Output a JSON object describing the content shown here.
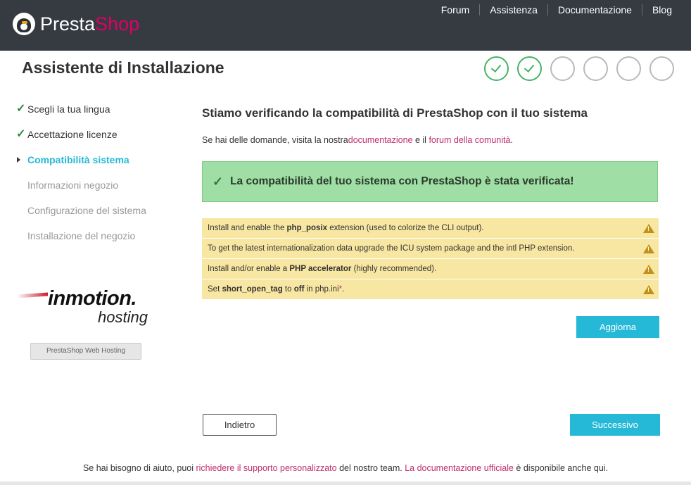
{
  "brand": {
    "logo_part1": "Presta",
    "logo_part2": "Shop"
  },
  "topnav": [
    "Forum",
    "Assistenza",
    "Documentazione",
    "Blog"
  ],
  "page_title": "Assistente di Installazione",
  "steps_progress": {
    "total": 6,
    "completed": 2
  },
  "sidebar": {
    "items": [
      {
        "label": "Scegli la tua lingua",
        "state": "done"
      },
      {
        "label": "Accettazione licenze",
        "state": "done"
      },
      {
        "label": "Compatibilità sistema",
        "state": "active"
      },
      {
        "label": "Informazioni negozio",
        "state": "todo"
      },
      {
        "label": "Configurazione del sistema",
        "state": "todo"
      },
      {
        "label": "Installazione del negozio",
        "state": "todo"
      }
    ],
    "partner_logo_top": "inmotion.",
    "partner_logo_bottom": "hosting",
    "partner_button": "PrestaShop Web Hosting"
  },
  "main": {
    "title": "Stiamo verificando la compatibilità di PrestaShop con il tuo sistema",
    "help_prefix": "Se hai delle domande, visita la nostra",
    "help_link1": "documentazione",
    "help_middle": " e il ",
    "help_link2": "forum della comunità",
    "help_suffix": ".",
    "success_message": "La compatibilità del tuo sistema con PrestaShop è stata verificata!",
    "warnings": [
      {
        "pre": "Install and enable the ",
        "bold": "php_posix",
        "post": " extension (used to colorize the CLI output)."
      },
      {
        "pre": "To get the latest internationalization data upgrade the ICU system package and the intl PHP extension.",
        "bold": "",
        "post": ""
      },
      {
        "pre": "Install and/or enable a ",
        "bold": "PHP accelerator",
        "post": " (highly recommended)."
      },
      {
        "pre": "Set ",
        "bold": "short_open_tag",
        "mid": " to ",
        "bold2": "off",
        "post": " in php.ini",
        "star": "*",
        "end": "."
      }
    ],
    "update_button": "Aggiorna",
    "back_button": "Indietro",
    "next_button": "Successivo"
  },
  "footer": {
    "prefix": "Se hai bisogno di aiuto, puoi ",
    "link1": "richiedere il supporto personalizzato",
    "middle": " del nostro team. ",
    "link2": "La documentazione ufficiale",
    "suffix": " è disponibile anche qui."
  },
  "colors": {
    "accent": "#25b9d7",
    "success": "#45b362",
    "link": "#bf2e6c",
    "header": "#363a41",
    "warning_bg": "#f8e7a2"
  }
}
